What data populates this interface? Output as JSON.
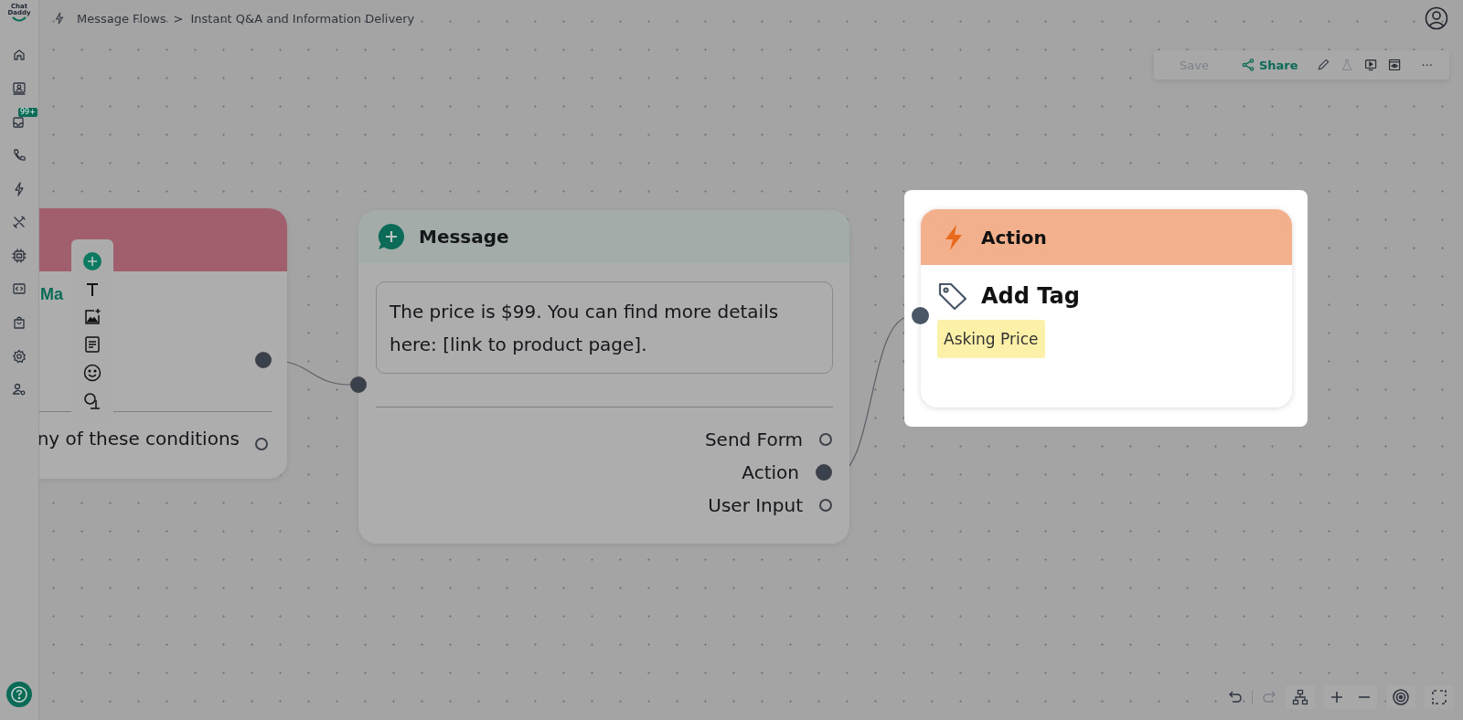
{
  "logo": {
    "line_1": "Chat",
    "line_2": "Daddy"
  },
  "sidebar": {
    "badge": "99+"
  },
  "breadcrumb": [
    {
      "label": "Message Flows"
    },
    {
      "label": "Instant Q&A and Information Delivery"
    }
  ],
  "breadcrumb_separator": ">",
  "toolbar": {
    "save": {
      "label": "Save",
      "disabled": true
    },
    "share": {
      "label": "Share"
    },
    "more": "···"
  },
  "left_node": {
    "title": "Ma",
    "condition": "ny of these conditions",
    "output_connected": true,
    "condition_connected": false
  },
  "message_node": {
    "title": "Message",
    "text": "The price is $99. You can find more details here: [link to product page].",
    "ports": [
      {
        "label": "Send Form",
        "connected": false
      },
      {
        "label": "Action",
        "connected": true
      },
      {
        "label": "User Input",
        "connected": false
      }
    ]
  },
  "action_node": {
    "title": "Action",
    "action": "Add Tag",
    "tag": "Asking Price",
    "selected": true
  }
}
